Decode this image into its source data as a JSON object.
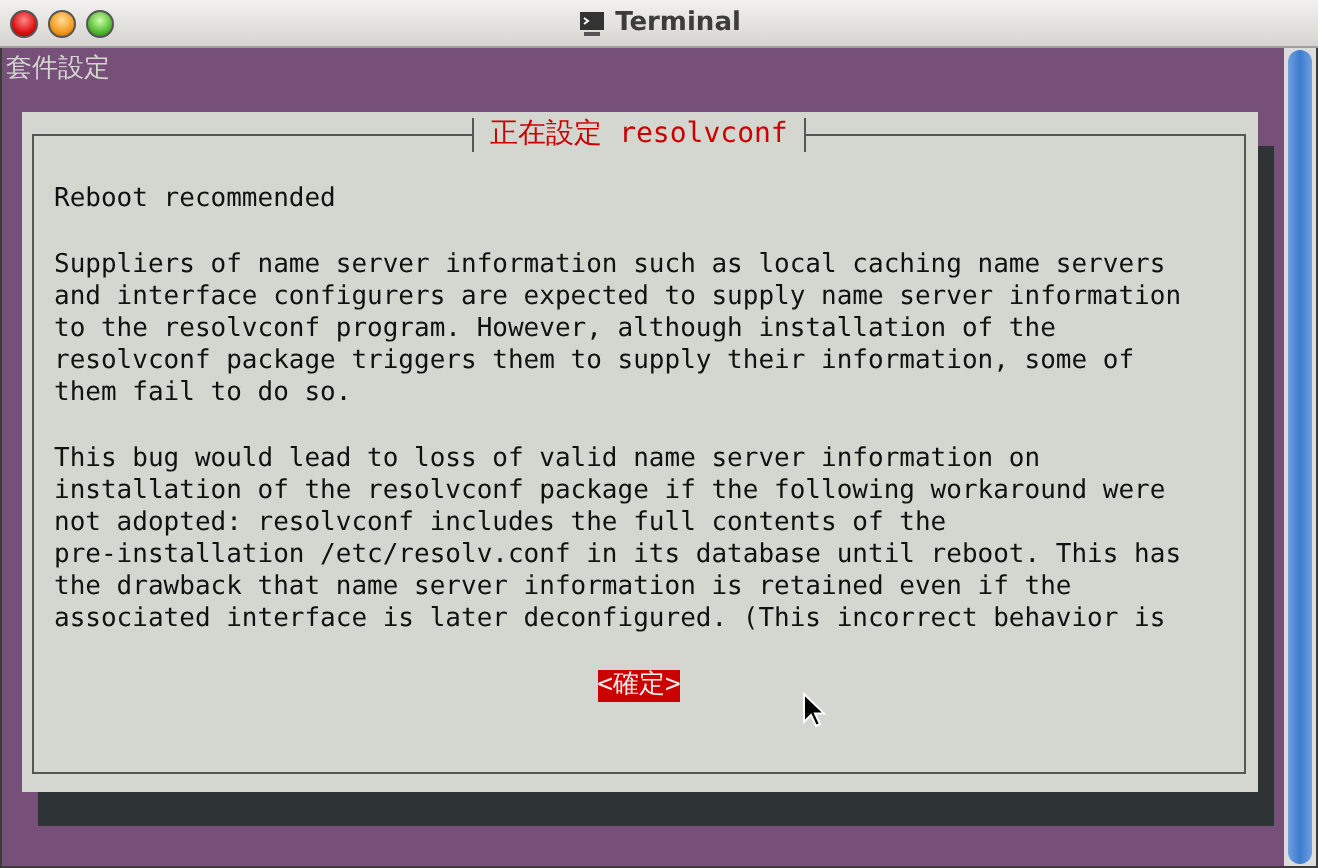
{
  "window": {
    "title": "Terminal"
  },
  "header": "套件設定",
  "dialog": {
    "title": "正在設定 resolvconf",
    "paragraphs": [
      [
        "Reboot recommended"
      ],
      [
        "Suppliers of name server information such as local caching name servers",
        "and interface configurers are expected to supply name server information",
        "to the resolvconf program. However, although installation of the",
        "resolvconf package triggers them to supply their information, some of",
        "them fail to do so."
      ],
      [
        "This bug would lead to loss of valid name server information on",
        "installation of the resolvconf package if the following workaround were",
        "not adopted: resolvconf includes the full contents of the",
        "pre-installation /etc/resolv.conf in its database until reboot. This has",
        "the drawback that name server information is retained even if the",
        "associated interface is later deconfigured. (This incorrect behavior is"
      ]
    ],
    "button": {
      "label": "<確定>",
      "selected": true
    }
  }
}
